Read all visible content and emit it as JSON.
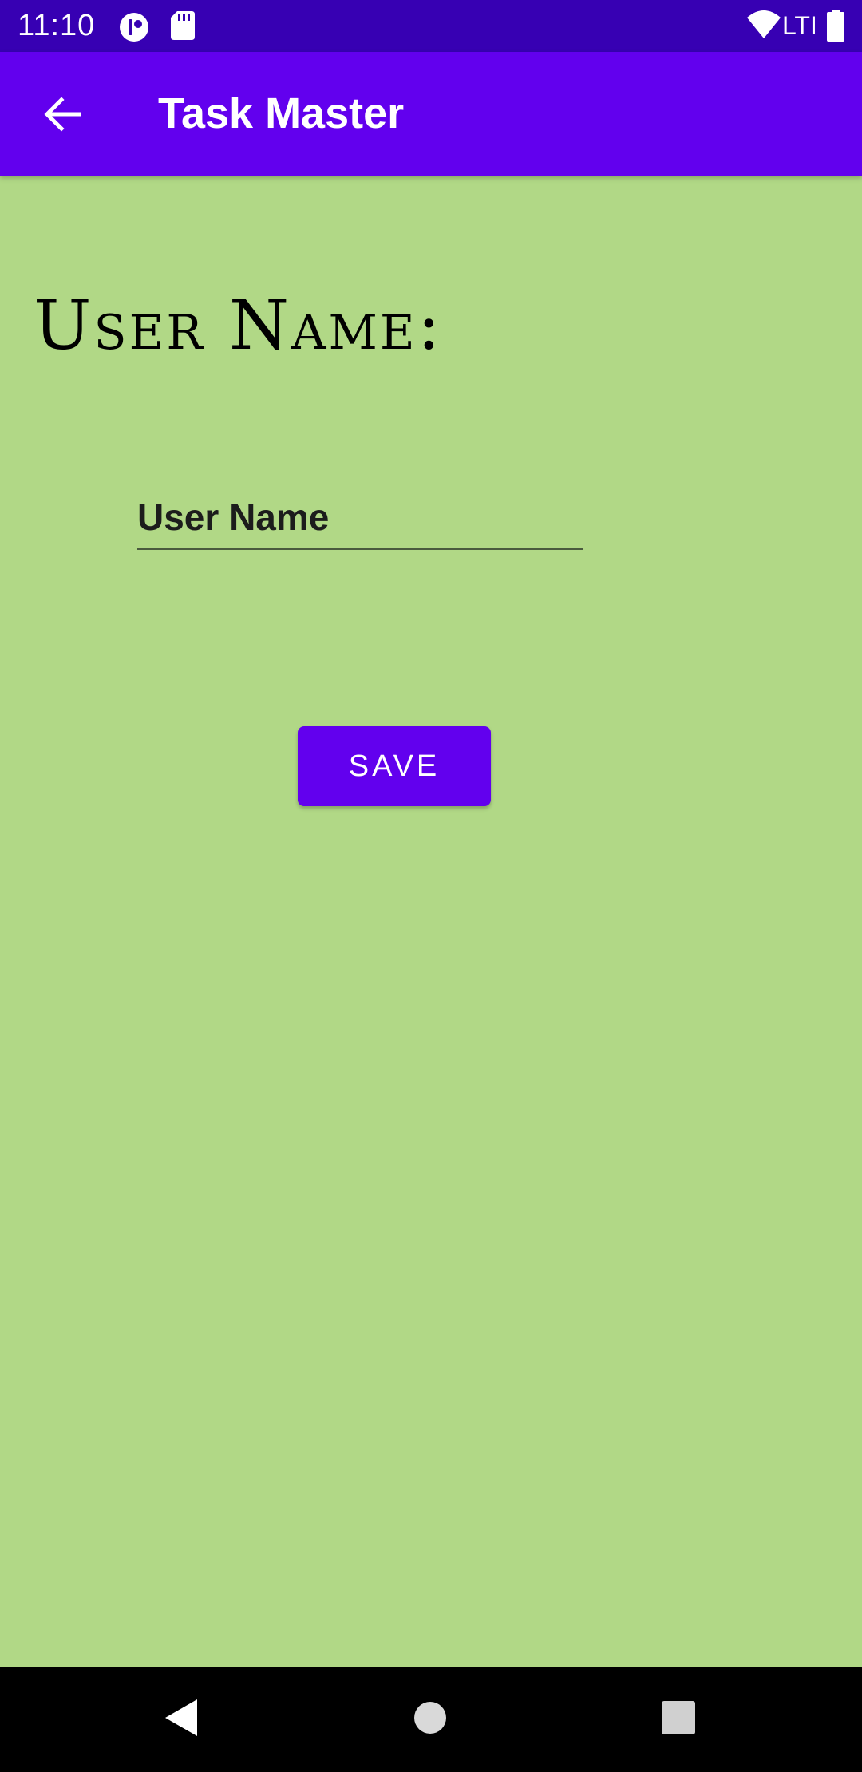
{
  "status_bar": {
    "time": "11:10",
    "network_label": "LTI",
    "icons": [
      "notification-app-icon",
      "sd-card-icon",
      "wifi-icon",
      "battery-icon"
    ]
  },
  "app_bar": {
    "title": "Task Master",
    "back_icon": "arrow-back-icon"
  },
  "main": {
    "heading": "User Name:",
    "user_name_input": {
      "value": "",
      "placeholder": "User Name"
    },
    "save_label": "SAVE"
  },
  "nav_bar": {
    "icons": [
      "back-triangle-icon",
      "home-circle-icon",
      "recents-square-icon"
    ]
  },
  "colors": {
    "background": "#b1d886",
    "status_bar": "#3700b3",
    "app_bar": "#6200ee",
    "button": "#6200ee"
  }
}
